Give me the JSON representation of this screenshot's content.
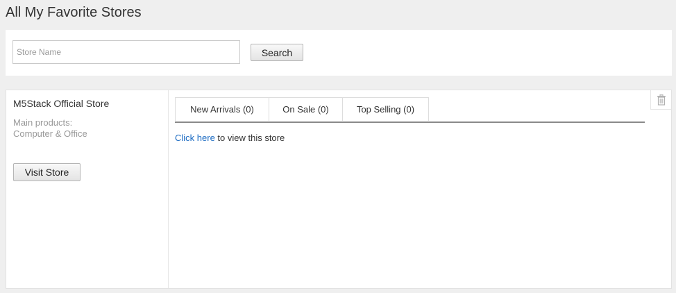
{
  "page": {
    "title": "All My Favorite Stores"
  },
  "search": {
    "placeholder": "Store Name",
    "value": "",
    "button_label": "Search"
  },
  "store": {
    "name": "M5Stack Official Store",
    "main_products_label": "Main products:",
    "main_products_value": "Computer & Office",
    "visit_label": "Visit Store",
    "tabs": [
      {
        "label": "New Arrivals (0)"
      },
      {
        "label": "On Sale (0)"
      },
      {
        "label": "Top Selling (0)"
      }
    ],
    "link_text": "Click here",
    "link_suffix": " to view this store",
    "delete_icon": "trash-icon"
  },
  "colors": {
    "background": "#efefef",
    "panel": "#ffffff",
    "link": "#1a6ac2",
    "muted_text": "#999999"
  }
}
